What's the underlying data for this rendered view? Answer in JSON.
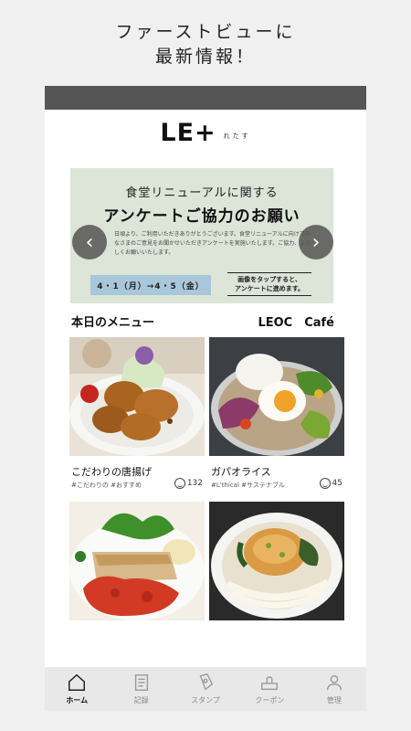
{
  "promo": {
    "line1": "ファーストビューに",
    "line2": "最新情報！"
  },
  "app": {
    "logo_main": "LE+",
    "logo_sub": "れたす"
  },
  "banner": {
    "title1": "食堂リニューアルに関する",
    "title2": "アンケートご協力のお願い",
    "body": "日頃より、ご利用いただきありがとうございます。食堂リニューアルに向けてみなさまのご意見をお聞かせいただきアンケートを実施いたします。ご協力、よろしくお願いいたします。",
    "date": "4・1（月）→4・5（金）",
    "note_line1": "画像をタップすると、",
    "note_line2": "アンケートに進めます。",
    "prev_icon": "chevron-left-icon",
    "next_icon": "chevron-right-icon"
  },
  "menu": {
    "heading": "本日のメニュー",
    "venue": "LEOC　Café",
    "items": [
      {
        "name": "こだわりの唐揚げ",
        "tags": "#こだわりの #おすすめ",
        "likes": "132"
      },
      {
        "name": "ガパオライス",
        "tags": "#L'thical #サステナブル",
        "likes": "45"
      },
      {
        "name": "",
        "tags": "",
        "likes": ""
      },
      {
        "name": "",
        "tags": "",
        "likes": ""
      }
    ]
  },
  "tabs": [
    {
      "label": "ホーム",
      "icon": "home-icon",
      "active": true
    },
    {
      "label": "記録",
      "icon": "record-icon",
      "active": false
    },
    {
      "label": "スタンプ",
      "icon": "stamp-icon",
      "active": false
    },
    {
      "label": "クーポン",
      "icon": "coupon-icon",
      "active": false
    },
    {
      "label": "管理",
      "icon": "user-icon",
      "active": false
    }
  ],
  "colors": {
    "statusbar": "#555555",
    "banner_bg": "#dde4d8",
    "date_bg": "#a9c7db",
    "tabbar_bg": "#e8e8e8"
  }
}
